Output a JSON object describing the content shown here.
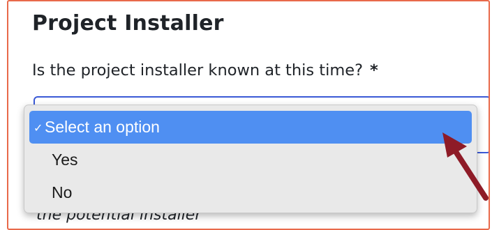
{
  "section": {
    "title": "Project Installer"
  },
  "question": {
    "label": "Is the project installer known at this time?",
    "required_marker": "*"
  },
  "select": {
    "selected_value": "Select an option",
    "options": [
      {
        "label": "Select an option",
        "selected": true,
        "check": "✓"
      },
      {
        "label": "Yes",
        "selected": false
      },
      {
        "label": "No",
        "selected": false
      }
    ]
  },
  "hint_text": "the potential installer",
  "colors": {
    "frame_border": "#e8694a",
    "select_border": "#3a59d6",
    "option_highlight": "#4f8ff2",
    "arrow": "#8e1b27"
  }
}
